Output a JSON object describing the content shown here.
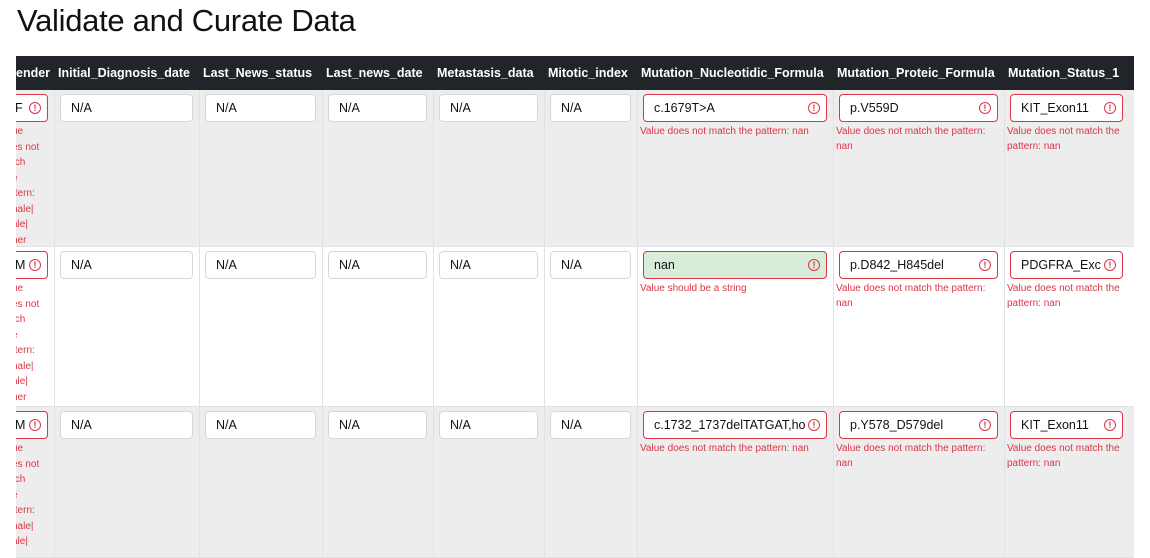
{
  "page": {
    "title": "Validate and Curate Data"
  },
  "columns": [
    {
      "key": "gender",
      "label": "ender"
    },
    {
      "key": "initial_diagnosis_date",
      "label": "Initial_Diagnosis_date"
    },
    {
      "key": "last_news_status",
      "label": "Last_News_status"
    },
    {
      "key": "last_news_date",
      "label": "Last_news_date"
    },
    {
      "key": "metastasis_data",
      "label": "Metastasis_data"
    },
    {
      "key": "mitotic_index",
      "label": "Mitotic_index"
    },
    {
      "key": "mutation_nucleotidic_formula",
      "label": "Mutation_Nucleotidic_Formula"
    },
    {
      "key": "mutation_proteic_formula",
      "label": "Mutation_Proteic_Formula"
    },
    {
      "key": "mutation_status_1",
      "label": "Mutation_Status_1"
    }
  ],
  "rows": [
    {
      "gender": {
        "value": "F",
        "error_lines": [
          "ue",
          "es not",
          "tch",
          "e",
          "ttern:",
          "nale|",
          "ale|",
          "her"
        ]
      },
      "initial_diagnosis_date": {
        "value": "N/A"
      },
      "last_news_status": {
        "value": "N/A"
      },
      "last_news_date": {
        "value": "N/A"
      },
      "metastasis_data": {
        "value": "N/A"
      },
      "mitotic_index": {
        "value": "N/A"
      },
      "mutation_nucleotidic_formula": {
        "value": "c.1679T>A",
        "error": "Value does not match the pattern: nan"
      },
      "mutation_proteic_formula": {
        "value": "p.V559D",
        "error": "Value does not match the pattern: nan"
      },
      "mutation_status_1": {
        "value": "KIT_Exon11",
        "error": "Value does not match the pattern: nan"
      }
    },
    {
      "gender": {
        "value": "M",
        "error_lines": [
          "ue",
          "es not",
          "tch",
          "e",
          "ttern:",
          "nale|",
          "ale|",
          "her"
        ]
      },
      "initial_diagnosis_date": {
        "value": "N/A"
      },
      "last_news_status": {
        "value": "N/A"
      },
      "last_news_date": {
        "value": "N/A"
      },
      "metastasis_data": {
        "value": "N/A"
      },
      "mitotic_index": {
        "value": "N/A"
      },
      "mutation_nucleotidic_formula": {
        "value": "nan",
        "error": "Value should be a string"
      },
      "mutation_proteic_formula": {
        "value": "p.D842_H845del",
        "error": "Value does not match the pattern: nan"
      },
      "mutation_status_1": {
        "value": "PDGFRA_Exc",
        "error": "Value does not match the pattern: nan"
      }
    },
    {
      "gender": {
        "value": "M",
        "error_lines": [
          "ue",
          "es not",
          "tch",
          "e",
          "ttern:",
          "nale|",
          "ale|"
        ]
      },
      "initial_diagnosis_date": {
        "value": "N/A"
      },
      "last_news_status": {
        "value": "N/A"
      },
      "last_news_date": {
        "value": "N/A"
      },
      "metastasis_data": {
        "value": "N/A"
      },
      "mitotic_index": {
        "value": "N/A"
      },
      "mutation_nucleotidic_formula": {
        "value": "c.1732_1737delTATGAT,ho",
        "error": "Value does not match the pattern: nan"
      },
      "mutation_proteic_formula": {
        "value": "p.Y578_D579del",
        "error": "Value does not match the pattern: nan"
      },
      "mutation_status_1": {
        "value": "KIT_Exon11",
        "error": "Value does not match the pattern: nan"
      }
    }
  ],
  "icons": {
    "warning": "exclamation-circle-icon"
  },
  "colors": {
    "header_bg": "#212529",
    "error": "#dc3545",
    "odd_row": "#ededed",
    "highlight": "#d9ecd9"
  }
}
